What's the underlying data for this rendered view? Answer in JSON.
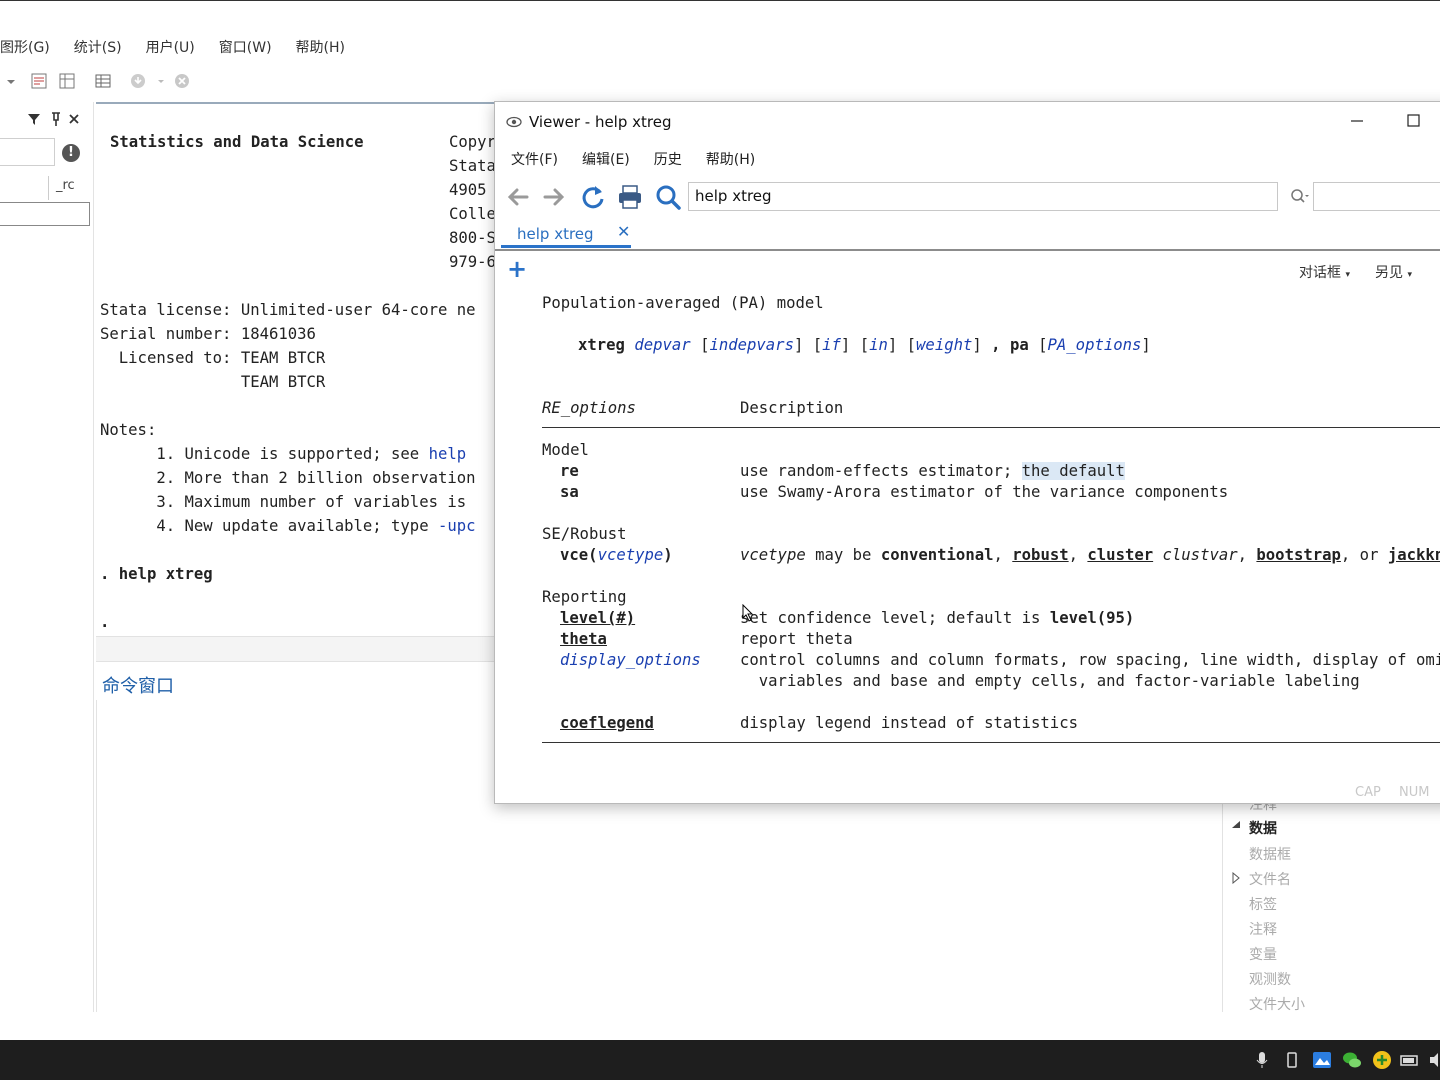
{
  "main": {
    "menu": [
      "图形(G)",
      "统计(S)",
      "用户(U)",
      "窗口(W)",
      "帮助(H)"
    ],
    "left": {
      "rc_label": "_rc"
    },
    "results": {
      "header_left": "Statistics and Data Science",
      "header_right": [
        "Copyr",
        "Stata",
        "4905",
        "Colle",
        "800-S",
        "979-6"
      ],
      "license": "Stata license: Unlimited-user 64-core ne",
      "serial": "Serial number: 18461036",
      "licensed_to_1": "  Licensed to: TEAM BTCR",
      "licensed_to_2": "               TEAM BTCR",
      "notes_title": "Notes:",
      "note1_pre": "      1. Unicode is supported; see ",
      "note1_link": "help",
      "note2": "      2. More than 2 billion observation",
      "note3": "      3. Maximum number of variables is",
      "note4_pre": "      4. New update available; type ",
      "note4_link": "-upc",
      "cmd_line": ". help xtreg",
      "prompt": "."
    },
    "command_window_title": "命令窗口"
  },
  "properties": {
    "cut_top": "注释",
    "section": "数据",
    "items": [
      "数据框",
      "文件名",
      "标签",
      "注释",
      "变量",
      "观测数",
      "文件大小"
    ]
  },
  "viewer": {
    "title": "Viewer - help xtreg",
    "menu": [
      "文件(F)",
      "编辑(E)",
      "历史",
      "帮助(H)"
    ],
    "search_value": "help xtreg",
    "tab_label": "help xtreg",
    "tab_close": "✕",
    "add_symbol": "+",
    "dialog_btn": "对话框",
    "seealso_btn": "另见",
    "status": {
      "cap": "CAP",
      "num": "NUM"
    },
    "help": {
      "heading": "Population-averaged (PA) model",
      "syntax": {
        "cmd": "xtreg",
        "depvar": "depvar",
        "indepvars": "indepvars",
        "if": "if",
        "in": "in",
        "weight": "weight",
        "comma": ",",
        "pa": "pa",
        "pa_options": "PA_options"
      },
      "col_options": "RE_options",
      "col_desc": "Description",
      "model_title": "Model",
      "re_opt": "re",
      "re_desc": "use random-effects estimator; ",
      "re_default": "the default",
      "sa_opt": "sa",
      "sa_desc": "use Swamy-Arora estimator of the variance components",
      "se_title": "SE/Robust",
      "vce_opt": "vce(",
      "vce_arg": "vcetype",
      "vce_close": ")",
      "vce_desc": {
        "vcetype": "vcetype",
        "may_be": " may be ",
        "conventional": "conventional",
        "robust": "robust",
        "cluster": "cluster",
        "clustvar": "clustvar",
        "bootstrap": "bootstrap",
        "or": ", or ",
        "jackknife": "jackknife"
      },
      "rep_title": "Reporting",
      "level_opt": "level(#)",
      "level_desc": "set confidence level; default is ",
      "level_default": "level(95)",
      "theta_opt": "theta",
      "theta_desc": "report theta",
      "disp_opt": "display_options",
      "disp_desc1": "control columns and column formats, row spacing, line width, display of omitte",
      "disp_desc2": "  variables and base and empty cells, and factor-variable labeling",
      "coef_opt": "coeflegend",
      "coef_desc": "display legend instead of statistics"
    }
  }
}
